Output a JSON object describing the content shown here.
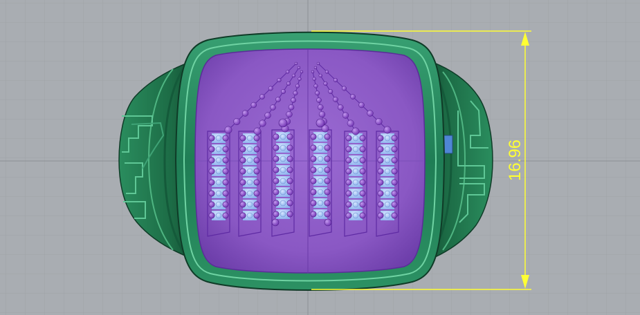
{
  "viewport": {
    "background": "#a9adb2",
    "grid": true,
    "grid_minor_color": "#9ea2a7",
    "grid_major_color": "#8d9196"
  },
  "model": {
    "ring_color": "#1f7d55",
    "ring_edge_color": "#57b98a",
    "face_color": "#8a58c4",
    "gem_color": "#7e3ec0",
    "gem_light_color": "#a9c8f4"
  },
  "dimension": {
    "value": "16.96",
    "color": "#ffff33"
  }
}
